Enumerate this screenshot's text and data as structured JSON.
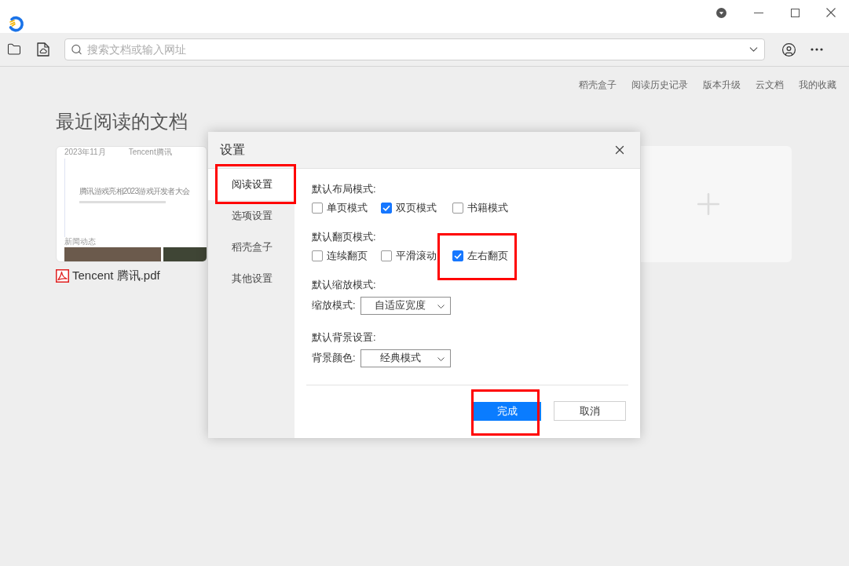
{
  "search": {
    "placeholder": "搜索文档或输入网址"
  },
  "links": [
    "稻壳盒子",
    "阅读历史记录",
    "版本升级",
    "云文档",
    "我的收藏"
  ],
  "recent": {
    "heading": "最近阅读的文档",
    "documents": [
      {
        "thumbnail": {
          "date": "2023年11月",
          "source": "Tencent腾讯",
          "title": "腾讯游戏亮相2023游戏开发者大会",
          "section": "新闻动态"
        },
        "name": "Tencent 腾讯.pdf"
      }
    ]
  },
  "dialog": {
    "title": "设置",
    "nav": [
      {
        "label": "阅读设置",
        "selected": true,
        "highlighted": true
      },
      {
        "label": "选项设置",
        "selected": false,
        "highlighted": false
      },
      {
        "label": "稻壳盒子",
        "selected": false,
        "highlighted": false
      },
      {
        "label": "其他设置",
        "selected": false,
        "highlighted": false
      }
    ],
    "sections": [
      {
        "kind": "checkboxes",
        "heading": "默认布局模式:",
        "options": [
          {
            "label": "单页模式",
            "checked": false,
            "highlighted": false
          },
          {
            "label": "双页模式",
            "checked": true,
            "highlighted": false
          },
          {
            "label": "书籍模式",
            "checked": false,
            "highlighted": false
          }
        ]
      },
      {
        "kind": "checkboxes",
        "heading": "默认翻页模式:",
        "options": [
          {
            "label": "连续翻页",
            "checked": false,
            "highlighted": false
          },
          {
            "label": "平滑滚动",
            "checked": false,
            "highlighted": false
          },
          {
            "label": "左右翻页",
            "checked": true,
            "highlighted": true
          }
        ]
      },
      {
        "kind": "select",
        "heading": "默认缩放模式:",
        "label": "缩放模式:",
        "value": "自适应宽度"
      },
      {
        "kind": "select",
        "heading": "默认背景设置:",
        "label": "背景颜色:",
        "value": "经典模式"
      }
    ],
    "buttons": [
      {
        "kind": "primary",
        "label": "完成",
        "highlighted": true
      },
      {
        "kind": "secondary",
        "label": "取消",
        "highlighted": false
      }
    ]
  }
}
